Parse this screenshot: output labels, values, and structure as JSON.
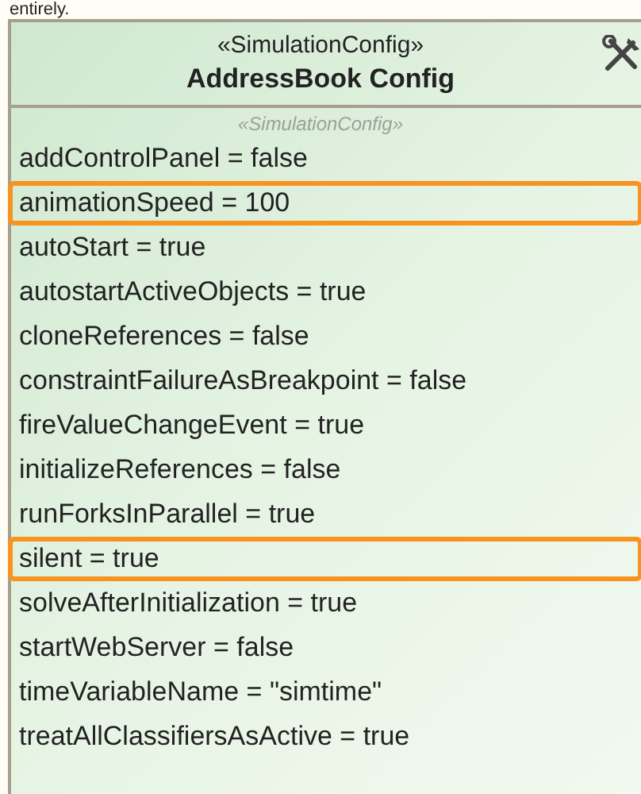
{
  "caption": "entirely.",
  "class_box": {
    "stereotype": "«SimulationConfig»",
    "name": "AddressBook Config",
    "compartment_stereotype": "«SimulationConfig»",
    "properties": [
      {
        "text": "addControlPanel = false",
        "highlighted": false
      },
      {
        "text": "animationSpeed = 100",
        "highlighted": true
      },
      {
        "text": "autoStart = true",
        "highlighted": false
      },
      {
        "text": "autostartActiveObjects = true",
        "highlighted": false
      },
      {
        "text": "cloneReferences = false",
        "highlighted": false
      },
      {
        "text": "constraintFailureAsBreakpoint = false",
        "highlighted": false
      },
      {
        "text": "fireValueChangeEvent = true",
        "highlighted": false
      },
      {
        "text": "initializeReferences = false",
        "highlighted": false
      },
      {
        "text": "runForksInParallel = true",
        "highlighted": false
      },
      {
        "text": "silent = true",
        "highlighted": true
      },
      {
        "text": "solveAfterInitialization = true",
        "highlighted": false
      },
      {
        "text": "startWebServer = false",
        "highlighted": false
      },
      {
        "text": "timeVariableName = \"simtime\"",
        "highlighted": false
      },
      {
        "text": "treatAllClassifiersAsActive = true",
        "highlighted": false
      }
    ]
  }
}
